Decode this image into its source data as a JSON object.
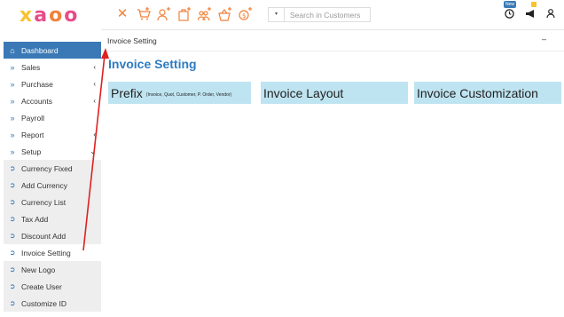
{
  "brand": {
    "letters": [
      "x",
      "a",
      "o",
      "o"
    ],
    "colors": [
      "#f6c431",
      "#e84b8a",
      "#f0823c",
      "#e84b8a"
    ]
  },
  "sidebar": {
    "items": [
      {
        "label": "Dashboard",
        "icon": "home-icon",
        "caret": ""
      },
      {
        "label": "Sales",
        "icon": "double-chevron-icon",
        "caret": "‹"
      },
      {
        "label": "Purchase",
        "icon": "double-chevron-icon",
        "caret": "‹"
      },
      {
        "label": "Accounts",
        "icon": "double-chevron-icon",
        "caret": "‹"
      },
      {
        "label": "Payroll",
        "icon": "double-chevron-icon",
        "caret": ""
      },
      {
        "label": "Report",
        "icon": "double-chevron-icon",
        "caret": "‹"
      },
      {
        "label": "Setup",
        "icon": "double-chevron-icon",
        "caret": "⌄"
      }
    ],
    "subitems": [
      {
        "label": "Currency Fixed"
      },
      {
        "label": "Add Currency"
      },
      {
        "label": "Currency List"
      },
      {
        "label": "Tax Add"
      },
      {
        "label": "Discount Add"
      },
      {
        "label": "Invoice Setting"
      },
      {
        "label": "New Logo"
      },
      {
        "label": "Create User"
      },
      {
        "label": "Customize ID"
      }
    ]
  },
  "topbar": {
    "icons": [
      "close-icon",
      "add-to-cart-icon",
      "add-user-icon",
      "add-bag-icon",
      "add-users-icon",
      "add-basket-icon",
      "add-money-icon"
    ],
    "search_placeholder": "Search in Customers",
    "search_dropdown": "▾",
    "badge_new": "New",
    "right_icons": [
      "clock-icon",
      "megaphone-icon",
      "user-icon"
    ]
  },
  "breadcrumb": {
    "label": "Invoice Setting",
    "collapse": "–"
  },
  "main": {
    "title": "Invoice Setting",
    "cards": [
      {
        "title": "Prefix",
        "subtitle": "(Invoice, Quot, Customer, P. Order, Vendor)"
      },
      {
        "title": "Invoice Layout",
        "subtitle": ""
      },
      {
        "title": "Invoice Customization",
        "subtitle": ""
      }
    ]
  },
  "colors": {
    "accent": "#3b79b6",
    "title": "#2d7cc1",
    "card_bg": "#bfe4f1",
    "toolbar_icon": "#f0823c",
    "annotation": "#e02020"
  }
}
